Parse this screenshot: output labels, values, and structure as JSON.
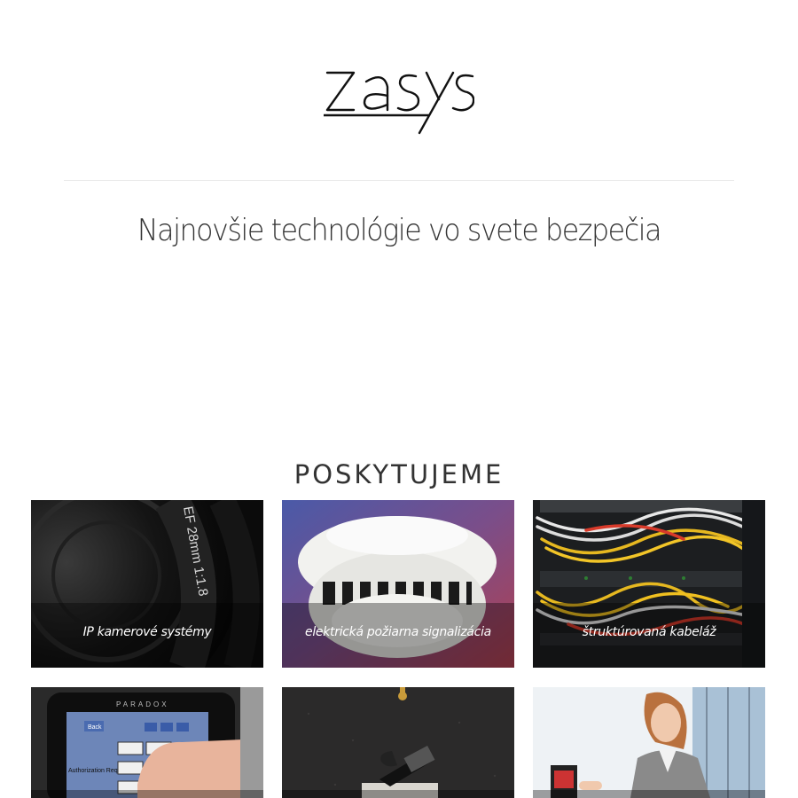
{
  "header": {
    "logo_text": "zasys",
    "tagline": "Najnovšie technológie vo svete bezpečia"
  },
  "services": {
    "heading": "POSKYTUJEME",
    "items": [
      {
        "label": "IP kamerové systémy",
        "image": "camera-lens"
      },
      {
        "label": "elektrická požiarna signalizácia",
        "image": "smoke-detector"
      },
      {
        "label": "štruktúrovaná kabeláž",
        "image": "network-rack-cables"
      },
      {
        "label": "",
        "image": "alarm-keypad"
      },
      {
        "label": "",
        "image": "desk-phone"
      },
      {
        "label": "",
        "image": "business-woman"
      }
    ]
  },
  "image_text": {
    "lens_marking": "EF 28mm 1:1.8",
    "keypad_brand": "PARADOX",
    "keypad_back": "Back",
    "keypad_auth": "Authorization Required"
  },
  "colors": {
    "text": "#333333",
    "caption": "#ffffff",
    "overlay": "rgba(0,0,0,0.35)"
  }
}
